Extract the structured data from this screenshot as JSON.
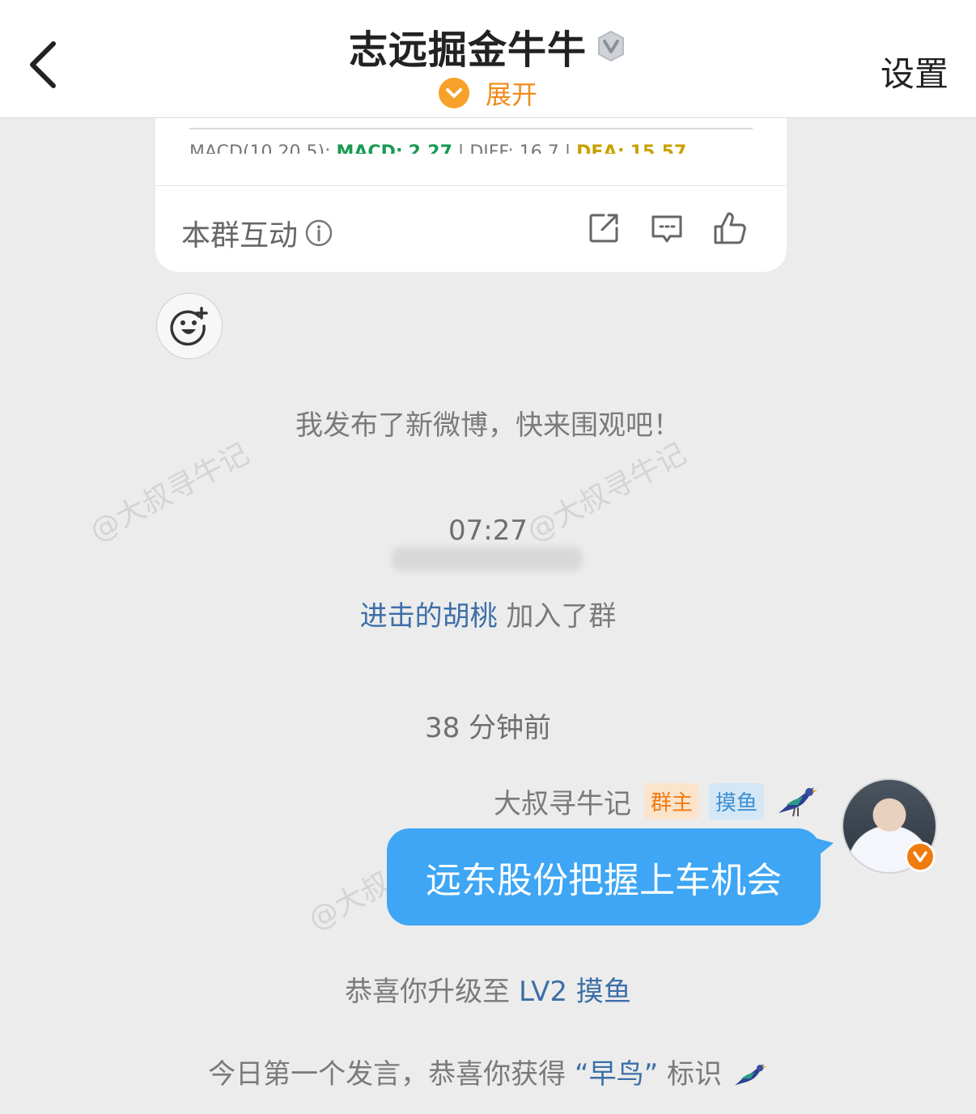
{
  "header": {
    "title": "志远掘金牛牛",
    "expand_label": "展开",
    "settings_label": "设置"
  },
  "card": {
    "macd": {
      "prefix": "MACD(10,20,5):",
      "macd_label": "MACD:",
      "macd_value": "2.27",
      "diff_label": "DIFF:",
      "diff_value": "16.7",
      "dea_label": "DEA:",
      "dea_value": "15.57"
    },
    "interaction_label": "本群互动"
  },
  "messages": {
    "post_notice": "我发布了新微博，快来围观吧！",
    "time_1": "07:27",
    "joined_user": "进击的胡桃",
    "joined_suffix": "加入了群",
    "time_2": "38 分钟前",
    "sender_name": "大叔寻牛记",
    "badge_owner": "群主",
    "badge_level": "摸鱼",
    "bubble_text": "远东股份把握上车机会",
    "upgrade_prefix": "恭喜你升级至",
    "upgrade_level": "LV2 摸鱼",
    "earlybird_prefix": "今日第一个发言，恭喜你获得",
    "earlybird_badge": "“早鸟”",
    "earlybird_suffix": "标识"
  },
  "watermarks": [
    "@大叔寻牛记",
    "@大叔寻牛记",
    "@大叔寻牛记"
  ],
  "colors": {
    "accent_orange": "#f08a1c",
    "bubble_blue": "#3ea6f5",
    "link_blue": "#3d6fa8",
    "background": "#ececec"
  },
  "icons": [
    "back-arrow-icon",
    "verified-v-icon",
    "chevron-down-icon",
    "info-icon",
    "share-icon",
    "comment-icon",
    "like-icon",
    "emoji-add-icon",
    "bird-icon",
    "verified-orange-icon"
  ]
}
